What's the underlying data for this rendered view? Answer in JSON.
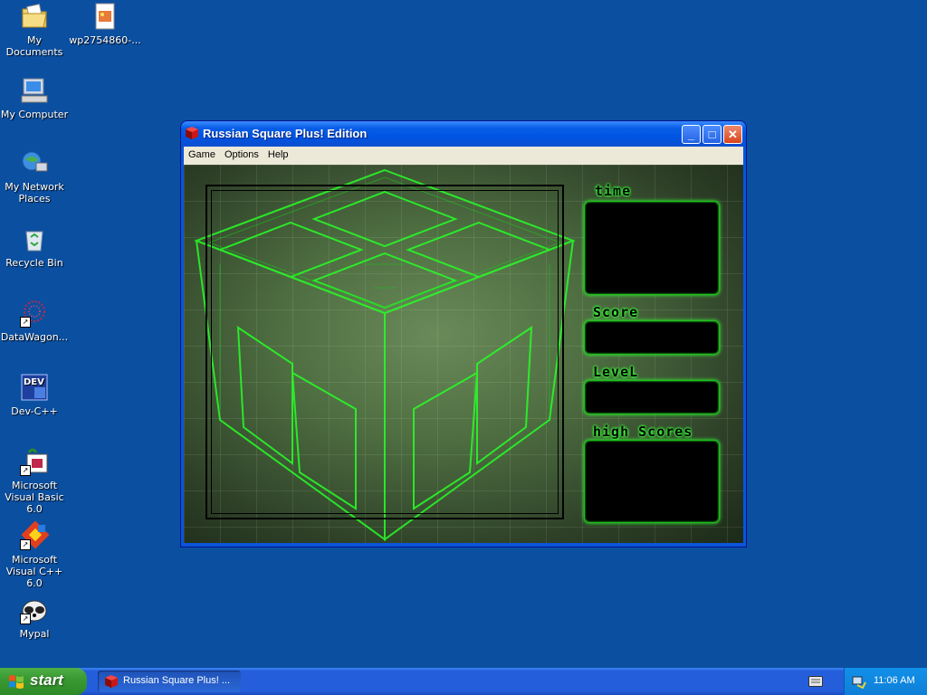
{
  "desktop": {
    "icons": [
      {
        "label": "My Documents",
        "icon": "folder-documents-icon"
      },
      {
        "label": "wp2754860-...",
        "icon": "image-file-icon"
      },
      {
        "label": "My Computer",
        "icon": "computer-icon"
      },
      {
        "label": "My Network Places",
        "icon": "network-icon"
      },
      {
        "label": "Recycle Bin",
        "icon": "recycle-bin-icon"
      },
      {
        "label": "DataWagon...",
        "icon": "datawagon-icon"
      },
      {
        "label": "Dev-C++",
        "icon": "devcpp-icon"
      },
      {
        "label": "Microsoft Visual Basic 6.0",
        "icon": "vb6-icon"
      },
      {
        "label": "Microsoft Visual C++ 6.0",
        "icon": "vcpp-icon"
      },
      {
        "label": "Mypal",
        "icon": "mypal-icon"
      }
    ],
    "devcpp_badge": "DEV"
  },
  "window": {
    "title": "Russian Square Plus! Edition",
    "controls": {
      "minimize": "_",
      "maximize": "□",
      "close": "✕"
    },
    "menu": [
      "Game",
      "Options",
      "Help"
    ],
    "panels": {
      "time": "time",
      "score": "Score",
      "level": "LeveL",
      "high_scores": "high Scores"
    }
  },
  "taskbar": {
    "start": "start",
    "task_label": "Russian Square Plus! ...",
    "clock": "11:06 AM"
  },
  "colors": {
    "desktop": "#0b4fa0",
    "glow": "#3dff3d",
    "titlebar": "#0054e3",
    "taskbar": "#245edb"
  }
}
